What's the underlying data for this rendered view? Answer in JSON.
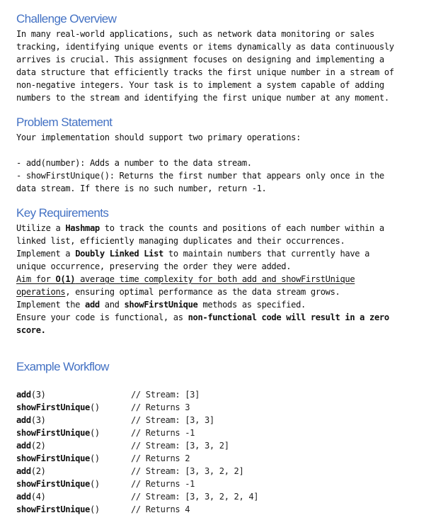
{
  "challenge_overview": {
    "title": "Challenge Overview",
    "lines": [
      "In many real-world applications, such as network data monitoring or sales",
      "tracking, identifying unique events or items dynamically as data continuously",
      "arrives is crucial. This assignment focuses on designing and implementing a",
      "data structure that efficiently tracks the first unique number in a stream of",
      "non-negative integers. Your task is to implement a system capable of adding",
      "numbers to the stream and identifying the first unique number at any moment."
    ]
  },
  "problem_statement": {
    "title": "Problem Statement",
    "intro": "Your implementation should support two primary operations:",
    "op1": "- add(number): Adds a number to the data stream.",
    "op2_line1": "- showFirstUnique(): Returns the first number that appears only once in the",
    "op2_line2": "data stream. If there is no such number, return -1."
  },
  "key_requirements": {
    "title": "Key Requirements",
    "r1": {
      "pre": "Utilize a ",
      "bold": "Hashmap",
      "post": " to track the counts and positions of each number within a",
      "line2": "linked list, efficiently managing duplicates and their occurrences."
    },
    "r2": {
      "pre": "Implement a ",
      "bold": "Doubly Linked List",
      "post": " to maintain numbers that currently have a",
      "line2": "unique occurrence, preserving the order they were added."
    },
    "r3": {
      "pre": "Aim for ",
      "bold": "O(1)",
      "post": " average time complexity for both add and showFirstUnique",
      "line2_underlined": "operations",
      "line2_rest": ", ensuring optimal performance as the data stream grows."
    },
    "r4": {
      "pre": "Implement the ",
      "bold1": "add",
      "mid": " and ",
      "bold2": "showFirstUnique",
      "post": " methods as specified."
    },
    "r5": {
      "pre": "Ensure your code is functional, as ",
      "bold": "non-functional code will result in a zero",
      "line2_bold": "score."
    }
  },
  "example_workflow": {
    "title": "Example Workflow",
    "steps": [
      {
        "fn": "add",
        "args": "(3)",
        "comment": "// Stream: [3]"
      },
      {
        "fn": "showFirstUnique",
        "args": "()",
        "comment": "// Returns 3"
      },
      {
        "fn": "add",
        "args": "(3)",
        "comment": "// Stream: [3, 3]"
      },
      {
        "fn": "showFirstUnique",
        "args": "()",
        "comment": "// Returns -1"
      },
      {
        "fn": "add",
        "args": "(2)",
        "comment": "// Stream: [3, 3, 2]"
      },
      {
        "fn": "showFirstUnique",
        "args": "()",
        "comment": "// Returns 2"
      },
      {
        "fn": "add",
        "args": "(2)",
        "comment": "// Stream: [3, 3, 2, 2]"
      },
      {
        "fn": "showFirstUnique",
        "args": "()",
        "comment": "// Returns -1"
      },
      {
        "fn": "add",
        "args": "(4)",
        "comment": "// Stream: [3, 3, 2, 2, 4]"
      },
      {
        "fn": "showFirstUnique",
        "args": "()",
        "comment": "// Returns 4"
      }
    ]
  }
}
